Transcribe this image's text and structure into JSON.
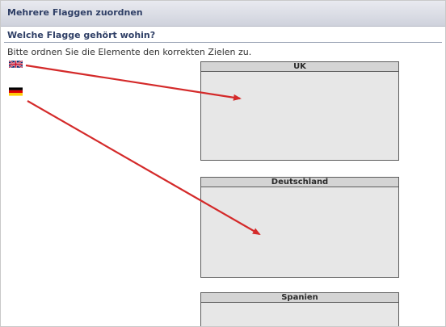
{
  "window": {
    "title": "Mehrere Flaggen zuordnen"
  },
  "question": {
    "title": "Welche Flagge gehört wohin?",
    "instruction": "Bitte ordnen Sie die Elemente den korrekten Zielen zu."
  },
  "flags": [
    {
      "id": "uk",
      "icon": "uk-flag-icon"
    },
    {
      "id": "de",
      "icon": "german-flag-icon"
    }
  ],
  "targets": [
    {
      "label": "UK"
    },
    {
      "label": "Deutschland"
    },
    {
      "label": "Spanien"
    }
  ],
  "colors": {
    "arrow": "#d42a2a",
    "target_fill": "#e7e7e7",
    "title_text": "#2f3f66"
  }
}
